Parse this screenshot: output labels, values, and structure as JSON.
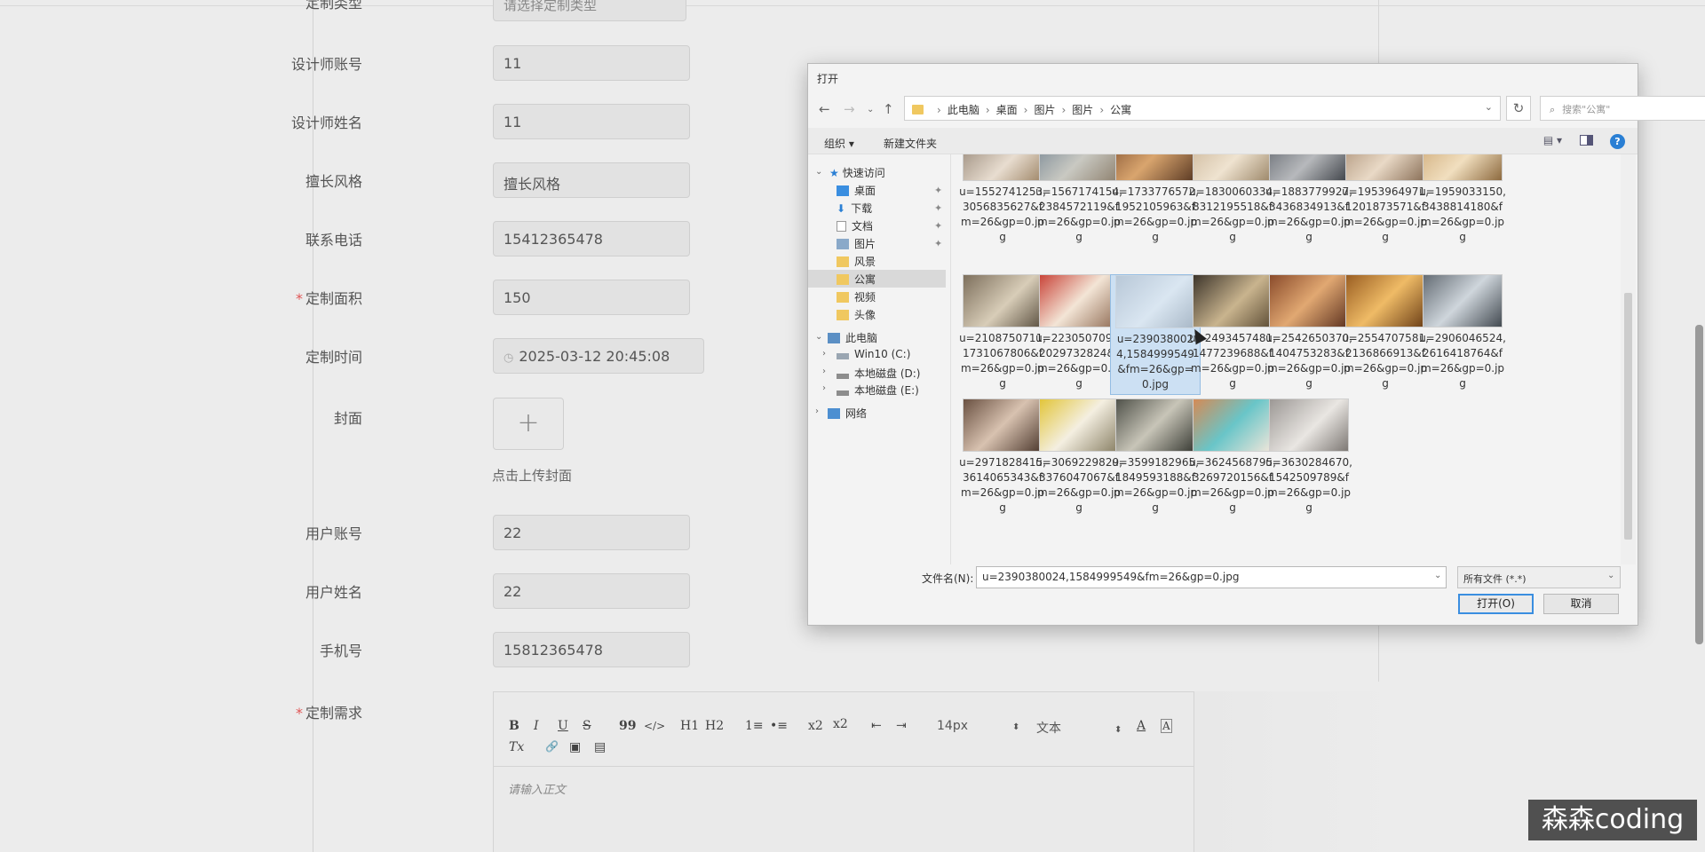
{
  "form": {
    "top_field": {
      "label": "定制类型",
      "placeholder": "请选择定制类型"
    },
    "designer_account": {
      "label": "设计师账号",
      "value": "11"
    },
    "designer_name": {
      "label": "设计师姓名",
      "value": "11"
    },
    "style": {
      "label": "擅长风格",
      "value": "擅长风格"
    },
    "phone": {
      "label": "联系电话",
      "value": "15412365478"
    },
    "area": {
      "required": "*",
      "label": "定制面积",
      "value": "150"
    },
    "time": {
      "label": "定制时间",
      "value": "2025-03-12 20:45:08"
    },
    "cover": {
      "label": "封面",
      "plus": "+",
      "tip": "点击上传封面"
    },
    "user_account": {
      "label": "用户账号",
      "value": "22"
    },
    "user_name": {
      "label": "用户姓名",
      "value": "22"
    },
    "mobile": {
      "label": "手机号",
      "value": "15812365478"
    },
    "needs": {
      "required": "*",
      "label": "定制需求"
    }
  },
  "editor": {
    "bold": "B",
    "italic": "I",
    "underline": "U",
    "strike": "S",
    "quote": "99",
    "code": "</>",
    "h1": "H1",
    "h2": "H2",
    "ol": "1≡",
    "ul": "•≡",
    "sub": "x2",
    "sup": "x2",
    "outdent": "⇤",
    "indent": "⇥",
    "size": "14px",
    "font": "文本",
    "color": "A",
    "bg": "A",
    "clear": "Tx",
    "link": "🔗",
    "image": "▣",
    "video": "▤",
    "placeholder": "请输入正文"
  },
  "dialog": {
    "title": "打开",
    "breadcrumbs": [
      "此电脑",
      "桌面",
      "图片",
      "图片",
      "公寓"
    ],
    "search_placeholder": "搜索\"公寓\"",
    "organize": "组织 ▾",
    "new_folder": "新建文件夹",
    "nav": {
      "quick_access": "快速访问",
      "desktop": "桌面",
      "downloads": "下载",
      "documents": "文档",
      "pictures": "图片",
      "scenery": "风景",
      "apartment": "公寓",
      "videos": "视频",
      "avatar": "头像",
      "this_pc": "此电脑",
      "drive_c": "Win10 (C:)",
      "drive_d": "本地磁盘 (D:)",
      "drive_e": "本地磁盘 (E:)",
      "network": "网络"
    },
    "files": [
      "u=1552741253,3056835627&fm=26&gp=0.jpg",
      "u=1567174154,2384572119&fm=26&gp=0.jpg",
      "u=1733776572,1952105963&fm=26&gp=0.jpg",
      "u=1830060334,8312195518&fm=26&gp=0.jpg",
      "u=1883779927,3436834913&fm=26&gp=0.jpg",
      "u=1953964971,1201873571&fm=26&gp=0.jpg",
      "u=1959033150,3438814180&fm=26&gp=0.jpg",
      "u=2108750711,1731067806&fm=26&gp=0.jpg",
      "u=2230507093,2029732824&fm=26&gp=0.jpg",
      "u=2390380024,1584999549&fm=26&gp=0.jpg",
      "u=2493457481,1477239688&fm=26&gp=0.jpg",
      "u=2542650370,1404753283&fm=26&gp=0.jpg",
      "u=2554707581,2136866913&fm=26&gp=0.jpg",
      "u=2906046524,2616418764&fm=26&gp=0.jpg",
      "u=2971828415,3614065343&fm=26&gp=0.jpg",
      "u=3069229829,3376047067&fm=26&gp=0.jpg",
      "u=3599182965,1849593188&fm=26&gp=0.jpg",
      "u=3624568795,3269720156&fm=26&gp=0.jpg",
      "u=3630284670,1542509789&fm=26&gp=0.jpg"
    ],
    "selected_index": 9,
    "filename_label": "文件名(N):",
    "filename_value": "u=2390380024,1584999549&fm=26&gp=0.jpg",
    "filetype": "所有文件 (*.*)",
    "open": "打开(O)",
    "cancel": "取消"
  },
  "watermark": "森森coding",
  "colors": {
    "required": "#e05555",
    "selection": "#cce0f3",
    "accent": "#3a8ee0",
    "help": "#2a7fd4",
    "folder": "#f0c860"
  }
}
